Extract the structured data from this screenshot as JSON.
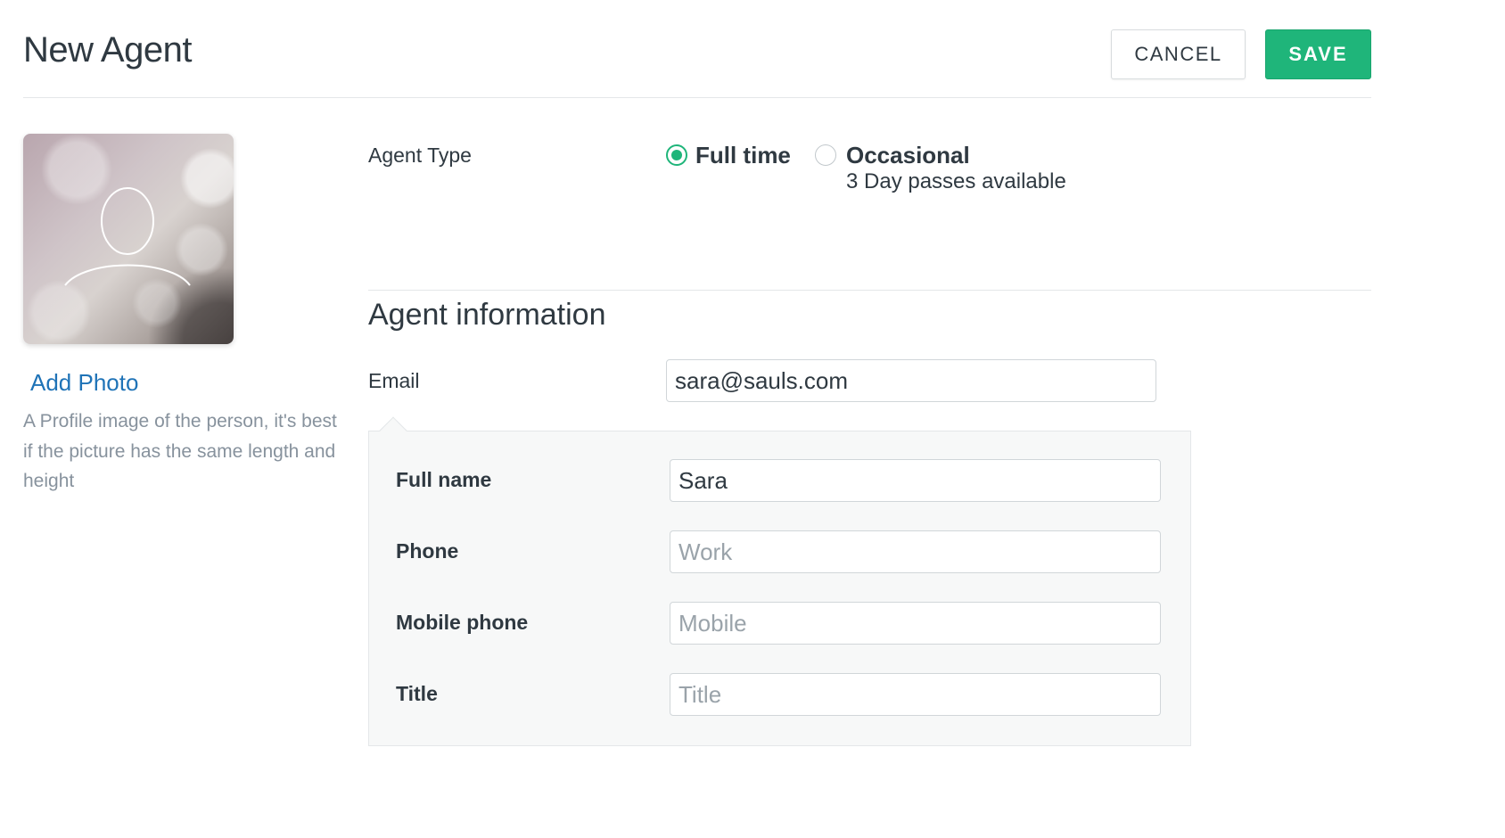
{
  "header": {
    "title": "New Agent",
    "cancel_label": "CANCEL",
    "save_label": "SAVE"
  },
  "photo": {
    "add_photo_label": "Add Photo",
    "hint": "A Profile image of the person, it's best if the picture has the same length and height"
  },
  "agent_type": {
    "label": "Agent Type",
    "options": [
      {
        "label": "Full time",
        "selected": true
      },
      {
        "label": "Occasional",
        "selected": false,
        "sublabel": "3 Day passes available"
      }
    ]
  },
  "agent_info": {
    "section_title": "Agent information",
    "email": {
      "label": "Email",
      "value": "sara@sauls.com",
      "placeholder": ""
    },
    "full_name": {
      "label": "Full name",
      "value": "Sara",
      "placeholder": ""
    },
    "phone": {
      "label": "Phone",
      "value": "",
      "placeholder": "Work"
    },
    "mobile_phone": {
      "label": "Mobile phone",
      "value": "",
      "placeholder": "Mobile"
    },
    "title": {
      "label": "Title",
      "value": "",
      "placeholder": "Title"
    }
  },
  "colors": {
    "accent_green": "#1fb57a",
    "link_blue": "#1f73b7",
    "text_dark": "#2f3941",
    "text_muted": "#87929d"
  },
  "icons": {
    "avatar_placeholder": "user-silhouette-icon"
  }
}
